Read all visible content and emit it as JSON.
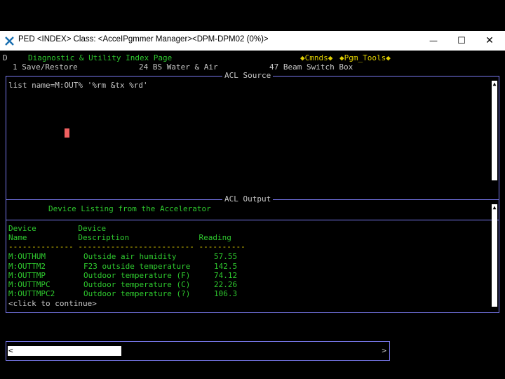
{
  "window": {
    "title": "PED <INDEX> Class: <AcceIPgmmer Manager><DPM-DPM02 (0%)>",
    "minimize_glyph": "—",
    "maximize_glyph": "☐",
    "close_glyph": "✕"
  },
  "header": {
    "menu_marker": "D",
    "page_title": "Diagnostic & Utility Index Page",
    "cmnds": "◆Cmnds◆",
    "pgm_tools": "◆Pgm_Tools◆",
    "items": [
      "1 Save/Restore",
      "24 BS Water & Air",
      "47 Beam Switch Box"
    ]
  },
  "acl_source": {
    "title": "ACL Source",
    "command": "list name=M:OUT% '%rm &tx %rd'"
  },
  "acl_output": {
    "title": "ACL Output",
    "heading": "Device Listing from the Accelerator",
    "col_headers_1": "Device         Device",
    "col_headers_2": "Name           Description               Reading",
    "separator": "-------------- ------------------------- ----------",
    "rows": [
      {
        "name": "M:OUTHUM",
        "description": "Outside air humidity",
        "reading": "57.55"
      },
      {
        "name": "M:OUTTM2",
        "description": "F23 outside temperature",
        "reading": "142.5"
      },
      {
        "name": "M:OUTTMP",
        "description": "Outdoor temperature (F)",
        "reading": "74.12"
      },
      {
        "name": "M:OUTTMPC",
        "description": "Outdoor temperature (C)",
        "reading": "22.26"
      },
      {
        "name": "M:OUTTMPC2",
        "description": "Outdoor temperature (?)",
        "reading": "106.3"
      }
    ],
    "continue_prompt": "<click to continue>"
  },
  "scrollbar": {
    "left_arrow": "<",
    "right_arrow": ">"
  },
  "colors": {
    "green": "#2ec82e",
    "gray": "#c8c8c8",
    "yellow": "#e0d000",
    "border": "#7a7af0",
    "cursor": "#f06060"
  }
}
